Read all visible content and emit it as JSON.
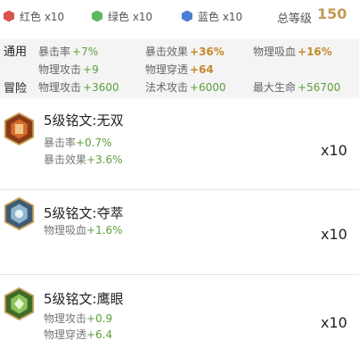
{
  "gems": [
    {
      "icon": "red-hexagon-icon",
      "color": "#d9534f",
      "label": "红色 x10"
    },
    {
      "icon": "green-hexagon-icon",
      "color": "#5cb85c",
      "label": "绿色 x10"
    },
    {
      "icon": "blue-hexagon-icon",
      "color": "#4a7fd6",
      "label": "蓝色 x10"
    }
  ],
  "total_level": {
    "label": "总等级",
    "value": "150"
  },
  "stats": {
    "general": {
      "label": "通用",
      "items": [
        {
          "name": "暴击率",
          "value": "+7%"
        },
        {
          "name": "暴击效果",
          "value": "+36%"
        },
        {
          "name": "物理吸血",
          "value": "+16%"
        },
        {
          "name": "物理攻击",
          "value": "+9"
        },
        {
          "name": "物理穿透",
          "value": "+64"
        }
      ]
    },
    "adventure": {
      "label": "冒险",
      "items": [
        {
          "name": "物理攻击",
          "value": "+3600"
        },
        {
          "name": "法术攻击",
          "value": "+6000"
        },
        {
          "name": "最大生命",
          "value": "+56700"
        }
      ]
    }
  },
  "runes": [
    {
      "icon": "red-rune-icon",
      "name": "5级铭文:无双",
      "lines": [
        "暴击率+0.7%",
        "暴击效果+3.6%"
      ],
      "qty": "x10"
    },
    {
      "icon": "blue-rune-icon",
      "name": "5级铭文:夺萃",
      "lines": [
        "物理吸血+1.6%"
      ],
      "qty": "x10"
    },
    {
      "icon": "green-rune-icon",
      "name": "5级铭文:鹰眼",
      "lines": [
        "物理攻击+0.9",
        "物理穿透+6.4"
      ],
      "qty": "x10"
    }
  ]
}
